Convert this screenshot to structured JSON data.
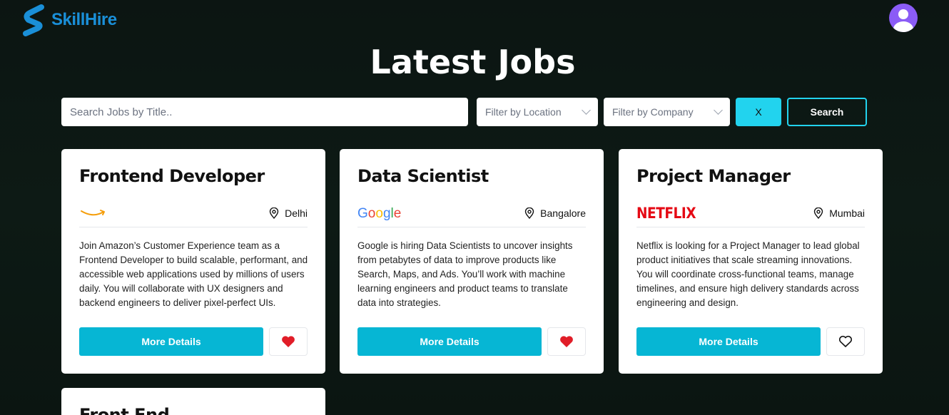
{
  "header": {
    "brand": "SkillHire",
    "page_title": "Latest Jobs"
  },
  "filters": {
    "search_placeholder": "Search Jobs by Title..",
    "location_placeholder": "Filter by Location",
    "company_placeholder": "Filter by Company",
    "clear_label": "X",
    "search_label": "Search"
  },
  "jobs": [
    {
      "title": "Frontend Developer",
      "company_logo": "amazon-logo",
      "location": "Delhi",
      "description": "Join Amazon’s Customer Experience team as a Frontend Developer to build scalable, performant, and accessible web applications used by millions of users daily. You will collaborate with UX designers and backend engineers to deliver pixel-perfect UIs.",
      "details_label": "More Details",
      "favorited": true
    },
    {
      "title": "Data Scientist",
      "company_logo": "google-logo",
      "company_logo_text": "Google",
      "location": "Bangalore",
      "description": "Google is hiring Data Scientists to uncover insights from petabytes of data to improve products like Search, Maps, and Ads. You’ll work with machine learning engineers and product teams to translate data into strategies.",
      "details_label": "More Details",
      "favorited": true
    },
    {
      "title": "Project Manager",
      "company_logo": "netflix-logo",
      "company_logo_text": "NETFLIX",
      "location": "Mumbai",
      "description": "Netflix is looking for a Project Manager to lead global product initiatives that scale streaming innovations. You will coordinate cross-functional teams, manage timelines, and ensure high delivery standards across engineering and design.",
      "details_label": "More Details",
      "favorited": false
    },
    {
      "title": "Front End"
    }
  ],
  "colors": {
    "accent": "#06b6d4",
    "accent_light": "#22d3ee",
    "brand": "#1a8fd8",
    "heart": "#e11d28",
    "avatar": "#8b5cf6"
  }
}
